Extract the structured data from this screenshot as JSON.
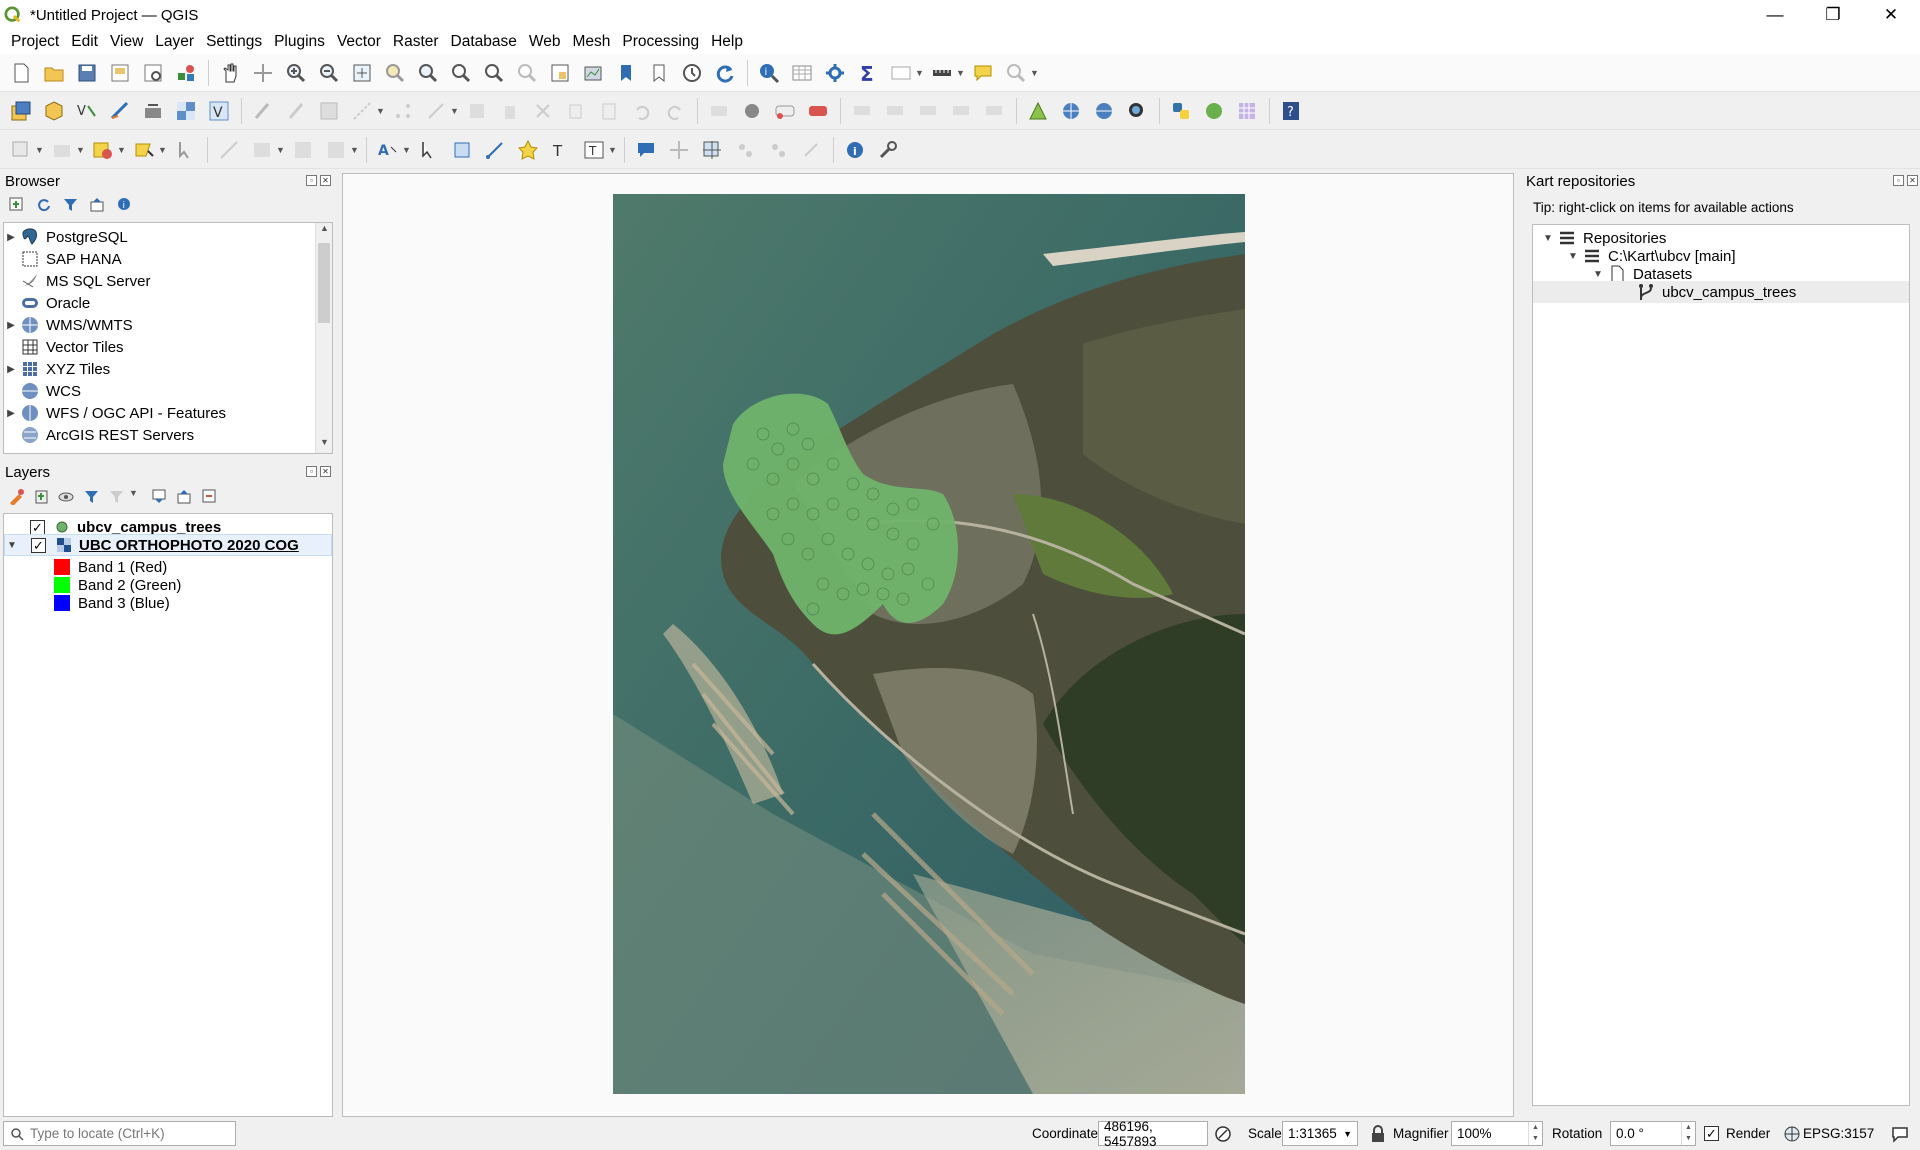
{
  "window": {
    "title": "*Untitled Project — QGIS",
    "minimize": "—",
    "restore": "❐",
    "close": "✕"
  },
  "menu": [
    "Project",
    "Edit",
    "View",
    "Layer",
    "Settings",
    "Plugins",
    "Vector",
    "Raster",
    "Database",
    "Web",
    "Mesh",
    "Processing",
    "Help"
  ],
  "browser": {
    "title": "Browser",
    "items": [
      {
        "label": "PostgreSQL",
        "icon": "postgresql-icon",
        "expandable": true
      },
      {
        "label": "SAP HANA",
        "icon": "sap-hana-icon",
        "expandable": false
      },
      {
        "label": "MS SQL Server",
        "icon": "mssql-icon",
        "expandable": false
      },
      {
        "label": "Oracle",
        "icon": "oracle-icon",
        "expandable": false
      },
      {
        "label": "WMS/WMTS",
        "icon": "wms-icon",
        "expandable": true
      },
      {
        "label": "Vector Tiles",
        "icon": "vector-tiles-icon",
        "expandable": false
      },
      {
        "label": "XYZ Tiles",
        "icon": "xyz-tiles-icon",
        "expandable": true
      },
      {
        "label": "WCS",
        "icon": "wcs-icon",
        "expandable": false
      },
      {
        "label": "WFS / OGC API - Features",
        "icon": "wfs-icon",
        "expandable": true
      },
      {
        "label": "ArcGIS REST Servers",
        "icon": "arcgis-icon",
        "expandable": false
      }
    ]
  },
  "layers": {
    "title": "Layers",
    "items": [
      {
        "label": "ubcv_campus_trees",
        "checked": true
      },
      {
        "label": "UBC ORTHOPHOTO 2020 COG",
        "checked": true
      },
      {
        "label": "Band 1 (Red)",
        "color": "#ff0000"
      },
      {
        "label": "Band 2 (Green)",
        "color": "#00ff00"
      },
      {
        "label": "Band 3 (Blue)",
        "color": "#0000ff"
      }
    ]
  },
  "kart": {
    "title": "Kart repositories",
    "tip": "Tip: right-click on items for available actions",
    "tree": [
      "Repositories",
      "C:\\Kart\\ubcv [main]",
      "Datasets",
      "ubcv_campus_trees"
    ]
  },
  "status": {
    "locate_placeholder": "Type to locate (Ctrl+K)",
    "coordinate_label": "Coordinate",
    "coordinate": "486196, 5457893",
    "scale_label": "Scale",
    "scale": "1:31365",
    "magnifier_label": "Magnifier",
    "magnifier": "100%",
    "rotation_label": "Rotation",
    "rotation": "0.0 °",
    "render_label": "Render",
    "crs": "EPSG:3157"
  },
  "colors": {
    "accent": "#1e6fd0",
    "trees": "#6fb36b",
    "water": "#3f6b62",
    "land": "#4d4f3c"
  }
}
